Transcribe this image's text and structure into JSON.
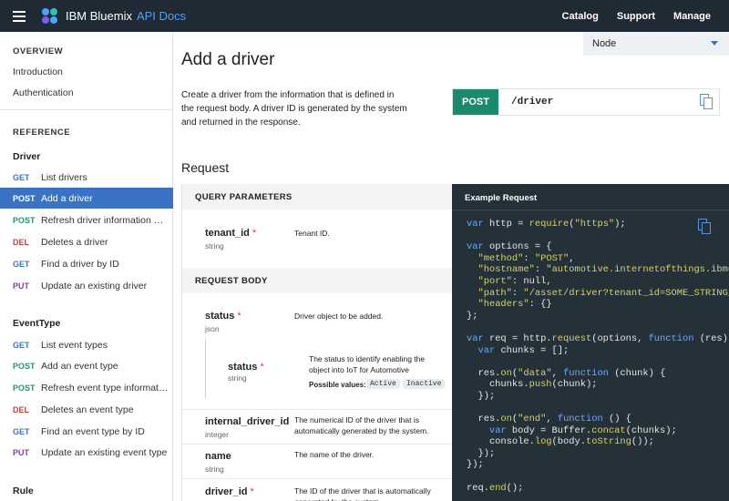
{
  "header": {
    "brand": "IBM Bluemix",
    "brand_sub": "API Docs",
    "nav": [
      "Catalog",
      "Support",
      "Manage"
    ]
  },
  "sidebar": {
    "overview_heading": "OVERVIEW",
    "overview_items": [
      "Introduction",
      "Authentication"
    ],
    "reference_heading": "REFERENCE",
    "groups": [
      {
        "name": "Driver",
        "items": [
          {
            "verb": "GET",
            "label": "List drivers"
          },
          {
            "verb": "POST",
            "label": "Add a driver"
          },
          {
            "verb": "POST",
            "label": "Refresh driver information on..."
          },
          {
            "verb": "DEL",
            "label": "Deletes a driver"
          },
          {
            "verb": "GET",
            "label": "Find a driver by ID"
          },
          {
            "verb": "PUT",
            "label": "Update an existing driver"
          }
        ]
      },
      {
        "name": "EventType",
        "items": [
          {
            "verb": "GET",
            "label": "List event types"
          },
          {
            "verb": "POST",
            "label": "Add an event type"
          },
          {
            "verb": "POST",
            "label": "Refresh event type informatio..."
          },
          {
            "verb": "DEL",
            "label": "Deletes an event type"
          },
          {
            "verb": "GET",
            "label": "Find an event type by ID"
          },
          {
            "verb": "PUT",
            "label": "Update an existing event type"
          }
        ]
      },
      {
        "name": "Rule",
        "items": []
      }
    ]
  },
  "language_select": {
    "value": "Node"
  },
  "main": {
    "title": "Add a driver",
    "description": "Create a driver from the information that is defined in the request body. A driver ID is generated by the system and returned in the response.",
    "endpoint": {
      "method": "POST",
      "path": "/driver"
    },
    "request_title": "Request",
    "query_params_heading": "QUERY PARAMETERS",
    "request_body_heading": "REQUEST BODY",
    "query_params": [
      {
        "name": "tenant_id",
        "type": "string",
        "description": "Tenant ID.",
        "required": "*"
      }
    ],
    "body_params": [
      {
        "name": "status",
        "type": "json",
        "description": "Driver object to be added.",
        "required": "*"
      },
      {
        "name": "internal_driver_id",
        "type": "integer",
        "description": "The numerical ID of the driver that is automatically generated by the system.",
        "required": ""
      },
      {
        "name": "name",
        "type": "string",
        "description": "The name of the driver.",
        "required": ""
      },
      {
        "name": "driver_id",
        "type": "",
        "description": "The ID of the driver that is automatically generated by the system.",
        "required": "*"
      }
    ],
    "nested_param": {
      "name": "status",
      "type": "string",
      "required": "*",
      "description": "The status to identify enabling the object into IoT for Automotive",
      "possible_label": "Possible values:",
      "possible_values": [
        "Active",
        "Inactive"
      ]
    }
  },
  "example": {
    "heading": "Example Request",
    "code_lines": [
      "var http = require(\"https\");",
      "",
      "var options = {",
      "  \"method\": \"POST\",",
      "  \"hostname\": \"automotive.internetofthings.ibmcl",
      "  \"port\": null,",
      "  \"path\": \"/asset/driver?tenant_id=SOME_STRING_V",
      "  \"headers\": {}",
      "};",
      "",
      "var req = http.request(options, function (res) {",
      "  var chunks = [];",
      "",
      "  res.on(\"data\", function (chunk) {",
      "    chunks.push(chunk);",
      "  });",
      "",
      "  res.on(\"end\", function () {",
      "    var body = Buffer.concat(chunks);",
      "    console.log(body.toString());",
      "  });",
      "});",
      "",
      "req.end();"
    ]
  },
  "colors": {
    "topbar_bg": "#1f2a34",
    "accent_blue": "#3a73c4",
    "post_green": "#1a8a6e",
    "code_bg": "#253138"
  },
  "icons": [
    "menu-icon",
    "bluemix-logo-icon",
    "chevron-down-icon",
    "copy-icon"
  ]
}
